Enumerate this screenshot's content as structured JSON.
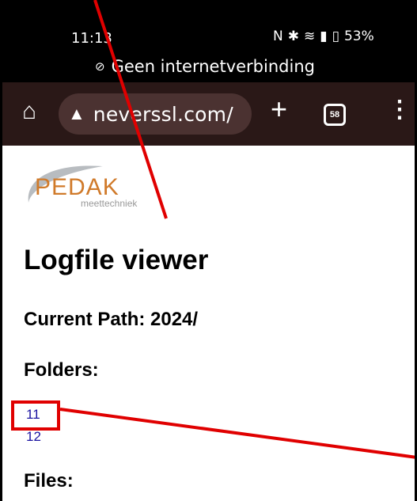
{
  "status_bar": {
    "time": "11:13",
    "icons": [
      "nfc-icon",
      "bluetooth-icon",
      "wifi-icon",
      "signal-icon",
      "battery-icon"
    ],
    "battery": "53%",
    "offline_text": "Geen internetverbinding"
  },
  "toolbar": {
    "url": "neverssl.com/",
    "tab_count": "58"
  },
  "logo": {
    "name": "PEDAK",
    "sub": "meettechniek"
  },
  "page": {
    "title": "Logfile viewer",
    "current_path": "Current Path: 2024/",
    "folders_heading": "Folders:",
    "folders": [
      "11",
      "12"
    ],
    "files_heading": "Files:"
  },
  "colors": {
    "link": "#1a12a0",
    "annotation": "#e00000",
    "toolbar_bg": "#2a1817",
    "logo_orange": "#d07a2a"
  }
}
